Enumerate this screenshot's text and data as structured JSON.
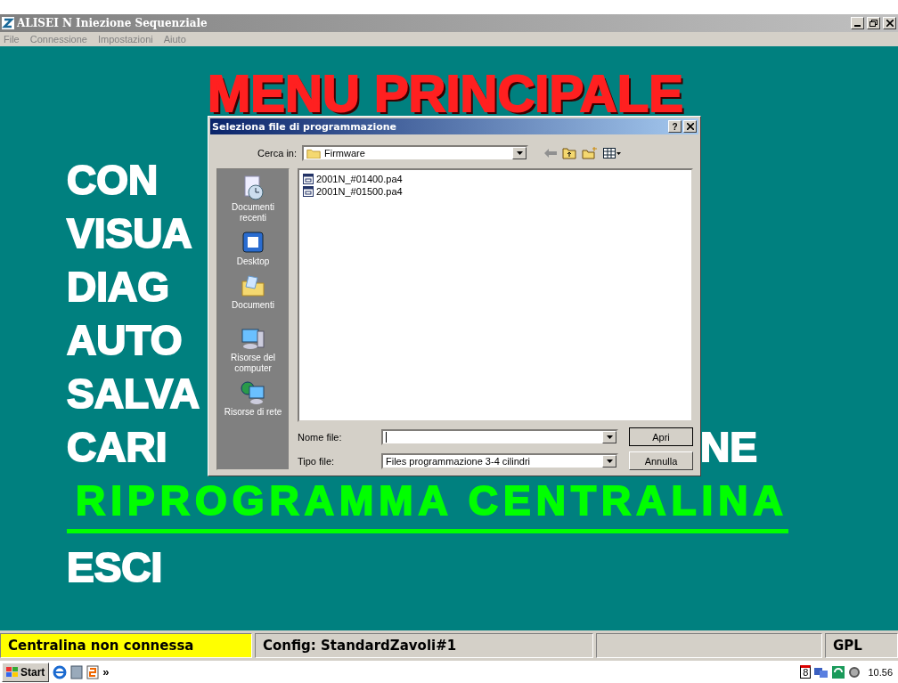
{
  "window": {
    "title": "ALISEI N Iniezione Sequenziale"
  },
  "menu_bar": [
    "File",
    "Connessione",
    "Impostazioni",
    "Aiuto"
  ],
  "main_menu": {
    "title": "MENU PRINCIPALE",
    "items": [
      {
        "label": "CON",
        "selected": false
      },
      {
        "label": "VISUA",
        "selected": false
      },
      {
        "label": "DIAG",
        "selected": false
      },
      {
        "label": "AUTO",
        "selected": false
      },
      {
        "label": "SALVA",
        "selected": false
      },
      {
        "label": "CARI",
        "label_tail": "NE",
        "selected": false
      },
      {
        "label": "RIPROGRAMMA CENTRALINA",
        "selected": true
      },
      {
        "label": "ESCI",
        "selected": false
      }
    ]
  },
  "dialog": {
    "title": "Seleziona file di programmazione",
    "help_button": "?",
    "look_in_label": "Cerca in:",
    "look_in_value": "Firmware",
    "places": [
      {
        "label": "Documenti recenti",
        "kind": "recent"
      },
      {
        "label": "Desktop",
        "kind": "desktop"
      },
      {
        "label": "Documenti",
        "kind": "documents"
      },
      {
        "label": "Risorse del computer",
        "kind": "computer"
      },
      {
        "label": "Risorse di rete",
        "kind": "network"
      }
    ],
    "files": [
      "2001N_#01400.pa4",
      "2001N_#01500.pa4"
    ],
    "file_name_label": "Nome file:",
    "file_type_label": "Tipo file:",
    "file_type_value": "Files programmazione 3-4 cilindri",
    "buttons": [
      "Apri",
      "Annulla"
    ]
  },
  "status_bar": {
    "connection": "Centralina non connessa",
    "config": "Config: StandardZavoli#1",
    "fuel": "GPL"
  },
  "taskbar": {
    "start": "Start",
    "more": "»",
    "calendar_day": "8",
    "clock": "10.56"
  }
}
